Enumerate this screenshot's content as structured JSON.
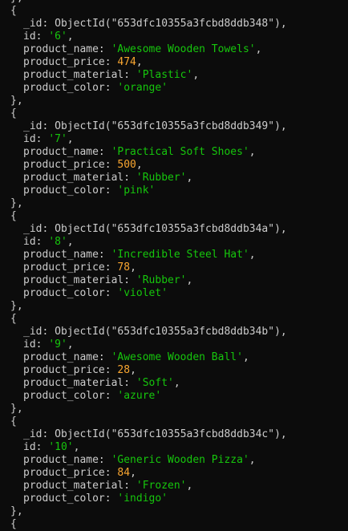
{
  "colors": {
    "background": "#0c0c0c",
    "text": "#cccccc",
    "string": "#16c60c",
    "number": "#f9a630"
  },
  "syntax": {
    "top_line": "},",
    "open_brace": "{",
    "close_brace": "},",
    "oid_prefix": "ObjectId(\"",
    "oid_suffix": "\"),"
  },
  "labels": {
    "_id": "_id",
    "id": "id",
    "product_name": "product_name",
    "product_price": "product_price",
    "product_material": "product_material",
    "product_color": "product_color"
  },
  "documents": [
    {
      "_id": "653dfc10355a3fcbd8ddb348",
      "id": "'6'",
      "product_name": "'Awesome Wooden Towels'",
      "product_price": "474",
      "product_material": "'Plastic'",
      "product_color": "'orange'"
    },
    {
      "_id": "653dfc10355a3fcbd8ddb349",
      "id": "'7'",
      "product_name": "'Practical Soft Shoes'",
      "product_price": "500",
      "product_material": "'Rubber'",
      "product_color": "'pink'"
    },
    {
      "_id": "653dfc10355a3fcbd8ddb34a",
      "id": "'8'",
      "product_name": "'Incredible Steel Hat'",
      "product_price": "78",
      "product_material": "'Rubber'",
      "product_color": "'violet'"
    },
    {
      "_id": "653dfc10355a3fcbd8ddb34b",
      "id": "'9'",
      "product_name": "'Awesome Wooden Ball'",
      "product_price": "28",
      "product_material": "'Soft'",
      "product_color": "'azure'"
    },
    {
      "_id": "653dfc10355a3fcbd8ddb34c",
      "id": "'10'",
      "product_name": "'Generic Wooden Pizza'",
      "product_price": "84",
      "product_material": "'Frozen'",
      "product_color": "'indigo'"
    }
  ]
}
